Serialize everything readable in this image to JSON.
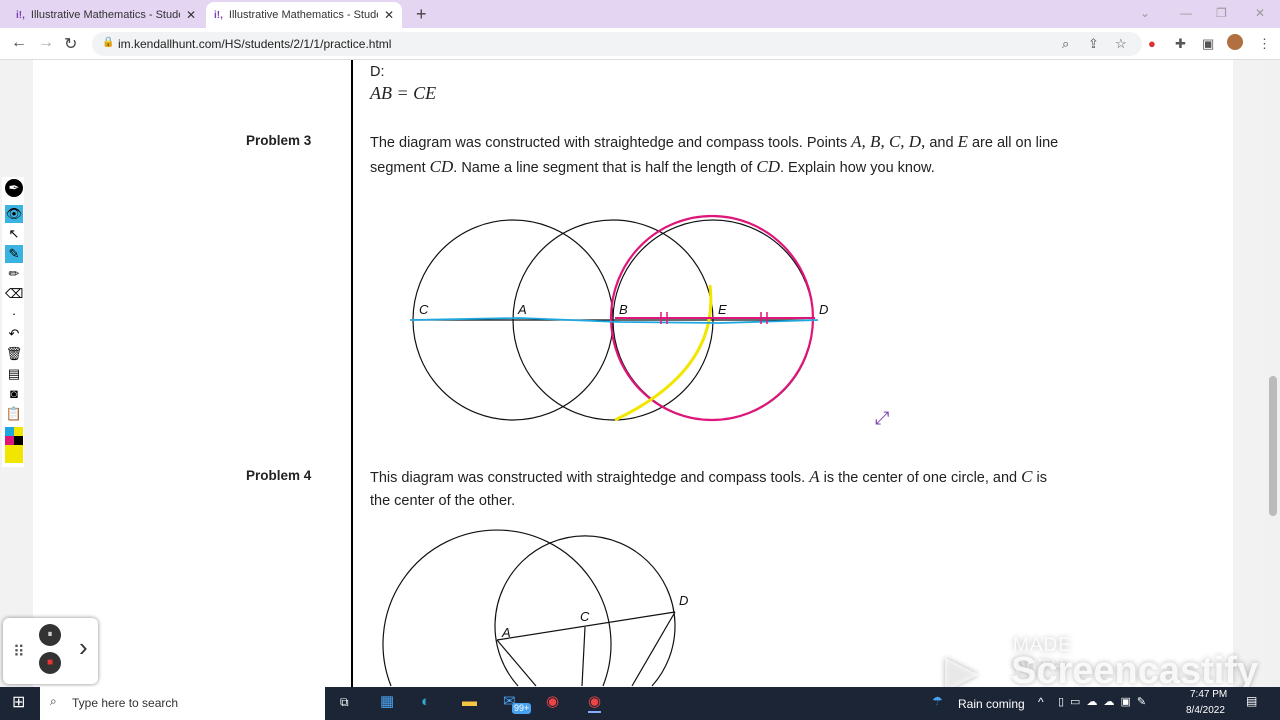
{
  "browser": {
    "tabs": [
      {
        "title": "Illustrative Mathematics - Studen"
      },
      {
        "title": "Illustrative Mathematics - Studen"
      }
    ],
    "url": "im.kendallhunt.com/HS/students/2/1/1/practice.html"
  },
  "content": {
    "prev_answer_label": "D:",
    "prev_answer_eq": "AB = CE",
    "problem3": {
      "label": "Problem 3",
      "text_parts": [
        "The diagram was constructed with straightedge and compass tools. Points ",
        "A, B, C, D,",
        " and ",
        "E",
        " are all on line segment ",
        "CD",
        ". Name a line segment that is half the length of ",
        "CD",
        ". Explain how you know."
      ],
      "points": [
        "C",
        "A",
        "B",
        "E",
        "D"
      ]
    },
    "problem4": {
      "label": "Problem 4",
      "text_parts": [
        "This diagram was constructed with straightedge and compass tools. ",
        "A",
        " is the center of one circle, and ",
        "C",
        " is the center of the other."
      ],
      "points": [
        "A",
        "C",
        "D"
      ]
    }
  },
  "recorder": {
    "pause": "⏸",
    "stop": "■",
    "next": "›"
  },
  "watermark": {
    "line1": "MADE WITH",
    "line2": "Screencastify"
  },
  "taskbar": {
    "search_placeholder": "Type here to search",
    "weather": "Rain coming",
    "time": "7:47 PM",
    "date": "8/4/2022",
    "badge": "99+"
  },
  "colors": {
    "pink": "#e0157a",
    "cyan": "#1fa8e0",
    "yellow": "#f2e600",
    "tab_bg": "#e4d5f2"
  }
}
